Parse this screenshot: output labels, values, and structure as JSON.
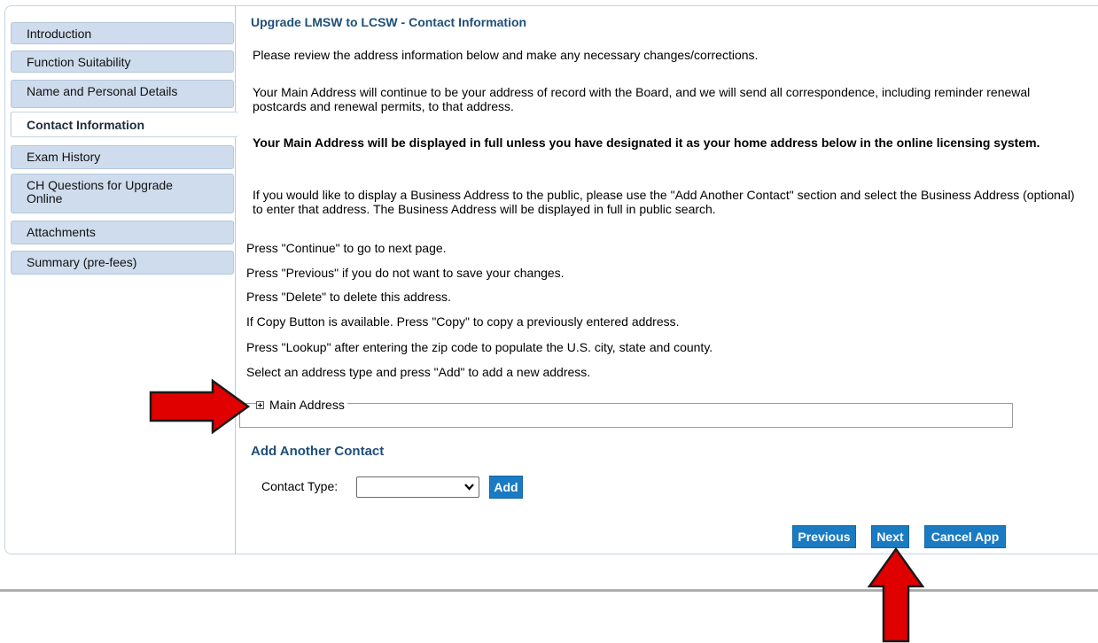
{
  "sidebar": {
    "items": [
      {
        "label": "Introduction"
      },
      {
        "label": "Function Suitability"
      },
      {
        "label": "Name and Personal Details"
      },
      {
        "label": "Contact Information"
      },
      {
        "label": "Exam History"
      },
      {
        "label": "CH Questions for Upgrade Online"
      },
      {
        "label": "Attachments"
      },
      {
        "label": "Summary (pre-fees)"
      }
    ]
  },
  "main": {
    "title": "Upgrade LMSW to LCSW - Contact Information",
    "intro": "Please review the address information below and make any necessary changes/corrections.",
    "main_address_note": "Your Main Address will continue to be your address of record with the Board, and we will send all correspondence, including reminder renewal postcards and renewal permits, to that address.",
    "display_note": "Your Main Address will be displayed in full unless you have designated it as your home address below in the online licensing system.",
    "business_note": "If you would like to display a Business Address to the public, please use the \"Add Another Contact\" section and select the Business Address (optional) to enter that address. The Business Address will be displayed in full in public search.",
    "instructions": [
      "Press \"Continue\" to go to next page.",
      "Press \"Previous\" if you do not want to save your changes.",
      "Press \"Delete\" to delete this address.",
      "If Copy Button is available. Press \"Copy\" to copy a previously entered address.",
      "Press \"Lookup\" after entering the zip code to populate the U.S. city, state and county.",
      "Select an address type and press \"Add\" to add a new address."
    ],
    "main_address_legend": "Main Address",
    "add_contact_title": "Add Another Contact",
    "contact_type_label": "Contact Type:",
    "contact_type_value": "",
    "add_button": "Add",
    "buttons": {
      "previous": "Previous",
      "next": "Next",
      "cancel": "Cancel App"
    }
  },
  "colors": {
    "accent": "#1a7bc3",
    "title": "#1f4f7a",
    "nav_bg": "#cfdced",
    "annotation_arrow": "#e00000"
  },
  "icons": {
    "expand": "plus-box-icon",
    "select": "chevron-down-icon",
    "annotation": "red-arrow-icon"
  }
}
